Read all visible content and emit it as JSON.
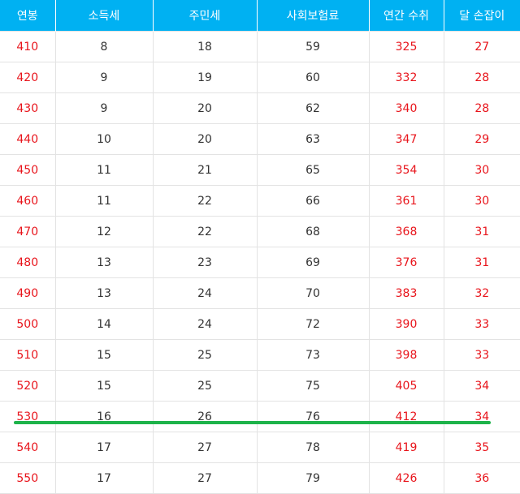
{
  "table": {
    "headers": [
      "연봉",
      "소득세",
      "주민세",
      "사회보험료",
      "연간 수취",
      "달 손잡이"
    ],
    "rows": [
      [
        "410",
        "8",
        "18",
        "59",
        "325",
        "27"
      ],
      [
        "420",
        "9",
        "19",
        "60",
        "332",
        "28"
      ],
      [
        "430",
        "9",
        "20",
        "62",
        "340",
        "28"
      ],
      [
        "440",
        "10",
        "20",
        "63",
        "347",
        "29"
      ],
      [
        "450",
        "11",
        "21",
        "65",
        "354",
        "30"
      ],
      [
        "460",
        "11",
        "22",
        "66",
        "361",
        "30"
      ],
      [
        "470",
        "12",
        "22",
        "68",
        "368",
        "31"
      ],
      [
        "480",
        "13",
        "23",
        "69",
        "376",
        "31"
      ],
      [
        "490",
        "13",
        "24",
        "70",
        "383",
        "32"
      ],
      [
        "500",
        "14",
        "24",
        "72",
        "390",
        "33"
      ],
      [
        "510",
        "15",
        "25",
        "73",
        "398",
        "33"
      ],
      [
        "520",
        "15",
        "25",
        "75",
        "405",
        "34"
      ],
      [
        "530",
        "16",
        "26",
        "76",
        "412",
        "34"
      ],
      [
        "540",
        "17",
        "27",
        "78",
        "419",
        "35"
      ],
      [
        "550",
        "17",
        "27",
        "79",
        "426",
        "36"
      ]
    ]
  },
  "colors": {
    "header_background": "#00b1f2",
    "header_text": "#ffffff",
    "highlight_text": "#e8141b",
    "regular_text": "#333333",
    "underline_marker": "#1db34a"
  }
}
